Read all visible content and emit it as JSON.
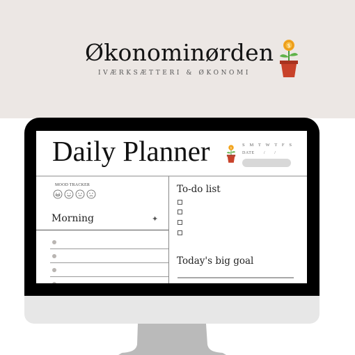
{
  "brand": {
    "title": "Økonominørden",
    "tagline": "IVÆRKSÆTTERI & ØKONOMI",
    "logo_icon": "money-plant-icon"
  },
  "planner": {
    "title": "Daily Planner",
    "title_icon": "money-plant-icon",
    "weekdays": "S M T W T   F S",
    "date_label": "DATE",
    "date_separators": [
      "/",
      "/"
    ],
    "mood_tracker": {
      "label": "MOOD TRACKER",
      "faces": [
        "laughing-face-icon",
        "smiling-face-icon",
        "neutral-face-icon",
        "sad-face-icon"
      ]
    },
    "morning": {
      "label": "Morning",
      "add_icon": "plus-sparkle-icon",
      "items": [
        "",
        "",
        "",
        ""
      ]
    },
    "todo": {
      "label": "To-do list",
      "items": [
        "",
        "",
        "",
        ""
      ]
    },
    "goal": {
      "label": "Today's big goal",
      "value": ""
    }
  },
  "colors": {
    "band_bg": "#ece7e4",
    "bezel": "#000000",
    "chin": "#e7e7e7",
    "stand": "#bababa",
    "coin": "#f2a51f",
    "leaf": "#5fb34a",
    "pot": "#c8422a"
  }
}
